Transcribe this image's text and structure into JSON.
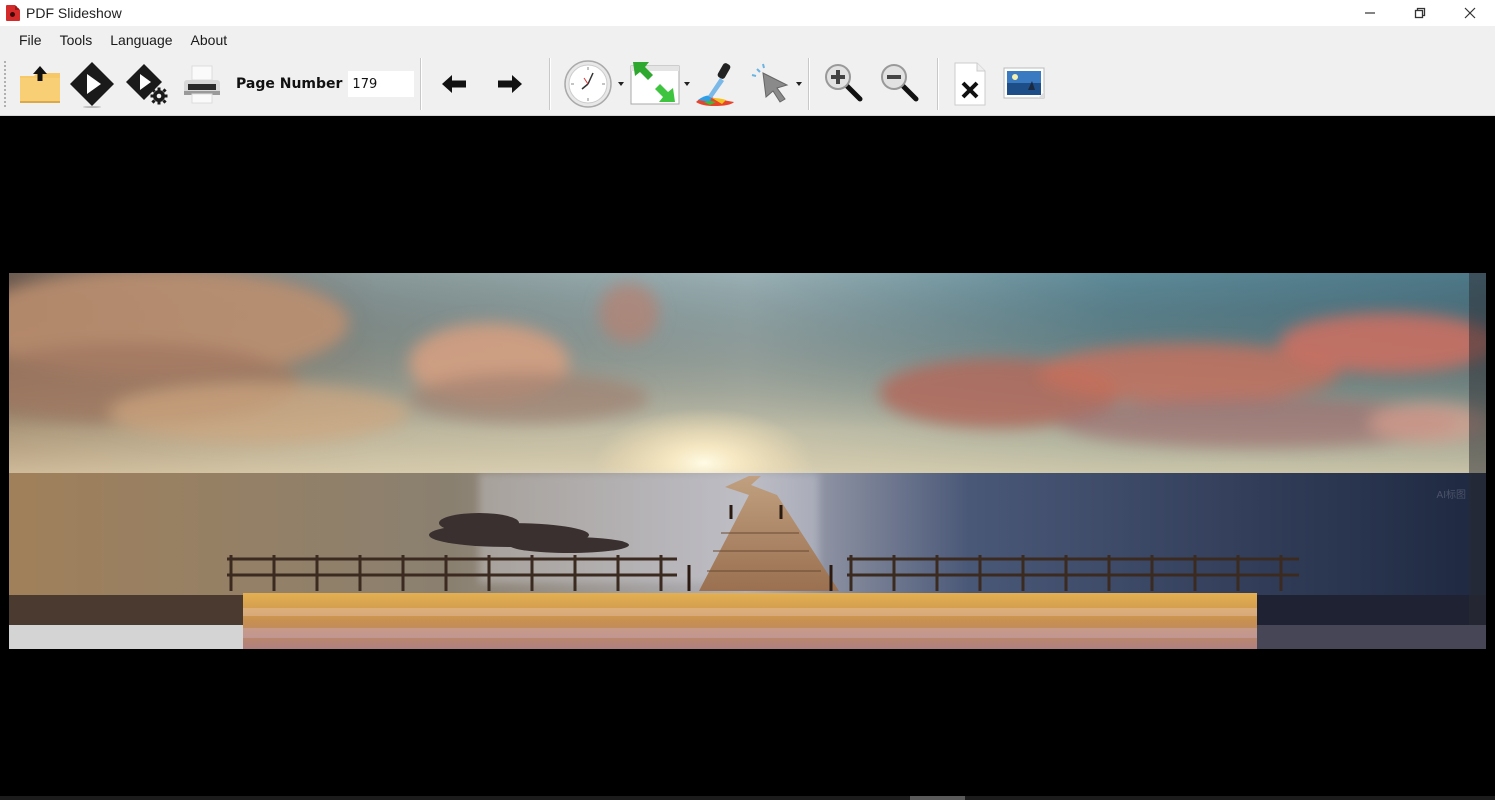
{
  "window": {
    "title": "PDF Slideshow",
    "controls": {
      "minimize": "—",
      "restore": "❐",
      "close": "✕"
    }
  },
  "menu": {
    "items": [
      {
        "label": "File"
      },
      {
        "label": "Tools"
      },
      {
        "label": "Language"
      },
      {
        "label": "About"
      }
    ]
  },
  "toolbar": {
    "buttons": [
      {
        "name": "open-file",
        "icon": "folder-upload-icon"
      },
      {
        "name": "play-slideshow",
        "icon": "play-diamond-icon"
      },
      {
        "name": "slideshow-settings",
        "icon": "play-gear-icon"
      },
      {
        "name": "print",
        "icon": "printer-icon"
      },
      {
        "name": "previous-page",
        "icon": "arrow-left-icon"
      },
      {
        "name": "next-page",
        "icon": "arrow-right-icon"
      },
      {
        "name": "timer",
        "icon": "clock-icon",
        "has_dropdown": true
      },
      {
        "name": "transition",
        "icon": "transition-arrows-icon",
        "has_dropdown": true
      },
      {
        "name": "background-color",
        "icon": "color-dropper-icon"
      },
      {
        "name": "pointer",
        "icon": "cursor-pointer-icon",
        "has_dropdown": true
      },
      {
        "name": "zoom-in",
        "icon": "zoom-in-icon"
      },
      {
        "name": "zoom-out",
        "icon": "zoom-out-icon"
      },
      {
        "name": "close-document",
        "icon": "close-document-icon"
      },
      {
        "name": "export-image",
        "icon": "image-icon"
      }
    ],
    "page_number_label": "Page Number",
    "page_number_value": "179"
  },
  "viewer": {
    "slide_description": "Panoramic sunset seascape with wooden pier leading to horizon, clouds and fences",
    "watermark": "AI标图",
    "colors": {
      "sky_blue": "#5e8a98",
      "cloud_orange": "#d89468",
      "cloud_pink": "#c86a5c",
      "sea_blue": "#2a3550",
      "sand_gold": "#d8a848",
      "pier_wood": "#a07a5a"
    }
  }
}
